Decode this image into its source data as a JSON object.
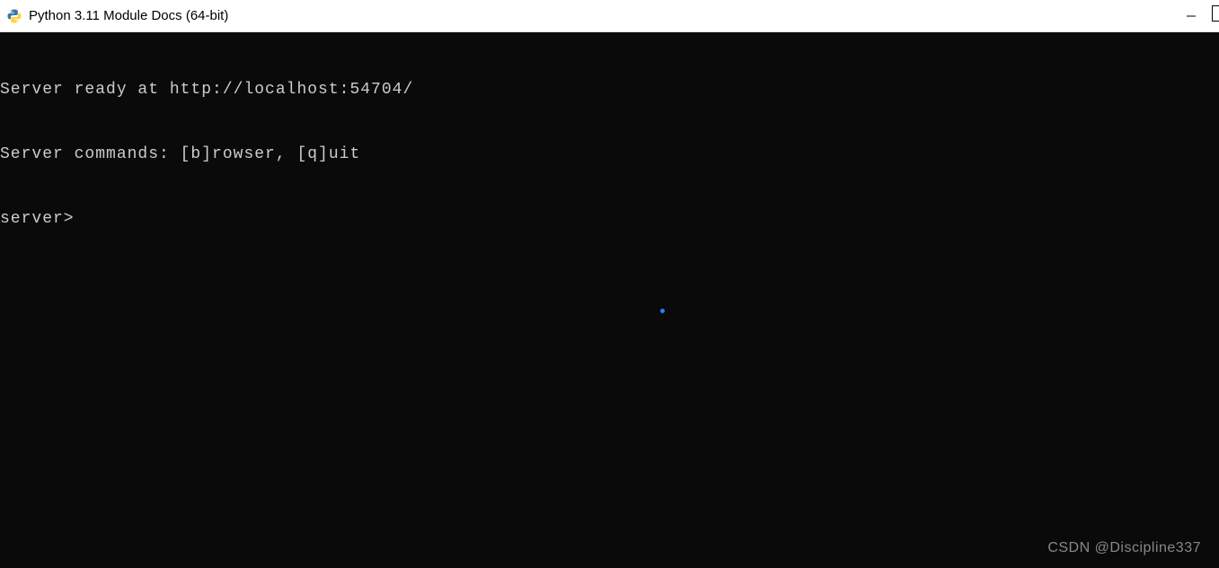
{
  "window": {
    "title": "Python 3.11 Module Docs (64-bit)",
    "icon_name": "python-icon"
  },
  "terminal": {
    "lines": [
      "Server ready at http://localhost:54704/",
      "Server commands: [b]rowser, [q]uit",
      "server>"
    ]
  },
  "watermark": "CSDN @Discipline337"
}
